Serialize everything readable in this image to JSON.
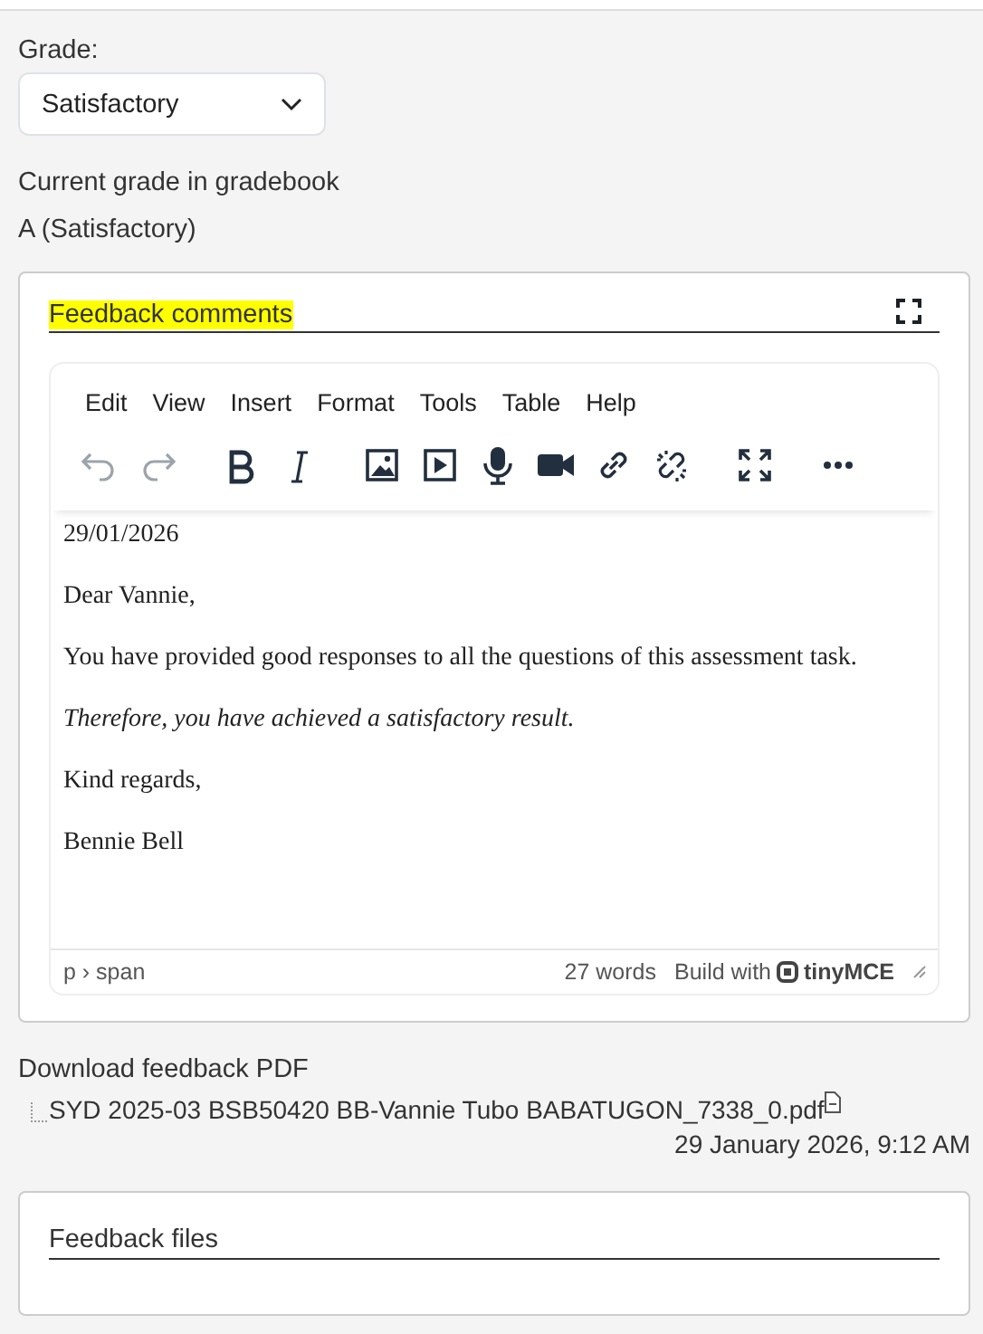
{
  "grade": {
    "label": "Grade:",
    "value": "Satisfactory"
  },
  "current_grade": {
    "label": "Current grade in gradebook",
    "value": "A (Satisfactory)"
  },
  "feedback_comments": {
    "title": "Feedback comments",
    "highlighted": true,
    "menu": [
      "Edit",
      "View",
      "Insert",
      "Format",
      "Tools",
      "Table",
      "Help"
    ],
    "toolbar": [
      {
        "kind": "undo",
        "disabled": true
      },
      {
        "kind": "redo",
        "disabled": true
      },
      {
        "kind": "bold",
        "disabled": false
      },
      {
        "kind": "italic",
        "disabled": false
      },
      {
        "kind": "image",
        "disabled": false
      },
      {
        "kind": "media",
        "disabled": false
      },
      {
        "kind": "mic",
        "disabled": false
      },
      {
        "kind": "video",
        "disabled": false
      },
      {
        "kind": "link",
        "disabled": false
      },
      {
        "kind": "unlink",
        "disabled": false
      },
      {
        "kind": "fullscreen",
        "disabled": false
      },
      {
        "kind": "more",
        "disabled": false
      }
    ],
    "paragraphs": [
      {
        "text": "29/01/2026",
        "italic": false
      },
      {
        "text": "Dear Vannie,",
        "italic": false
      },
      {
        "text": "You have provided good responses to all the questions of this assessment task.",
        "italic": false
      },
      {
        "text": "Therefore, you have achieved a satisfactory result.",
        "italic": true
      },
      {
        "text": "Kind regards,",
        "italic": false
      },
      {
        "text": "Bennie Bell",
        "italic": false
      }
    ],
    "status_bar": {
      "path": "p › span",
      "word_count": "27 words",
      "branding": "Build with",
      "brand": "tinyMCE"
    }
  },
  "download": {
    "label": "Download feedback PDF",
    "file": "SYD 2025-03 BSB50420 BB-Vannie Tubo BABATUGON_7338_0.pdf",
    "date": "29 January 2026, 9:12 AM"
  },
  "feedback_files": {
    "title": "Feedback files"
  }
}
